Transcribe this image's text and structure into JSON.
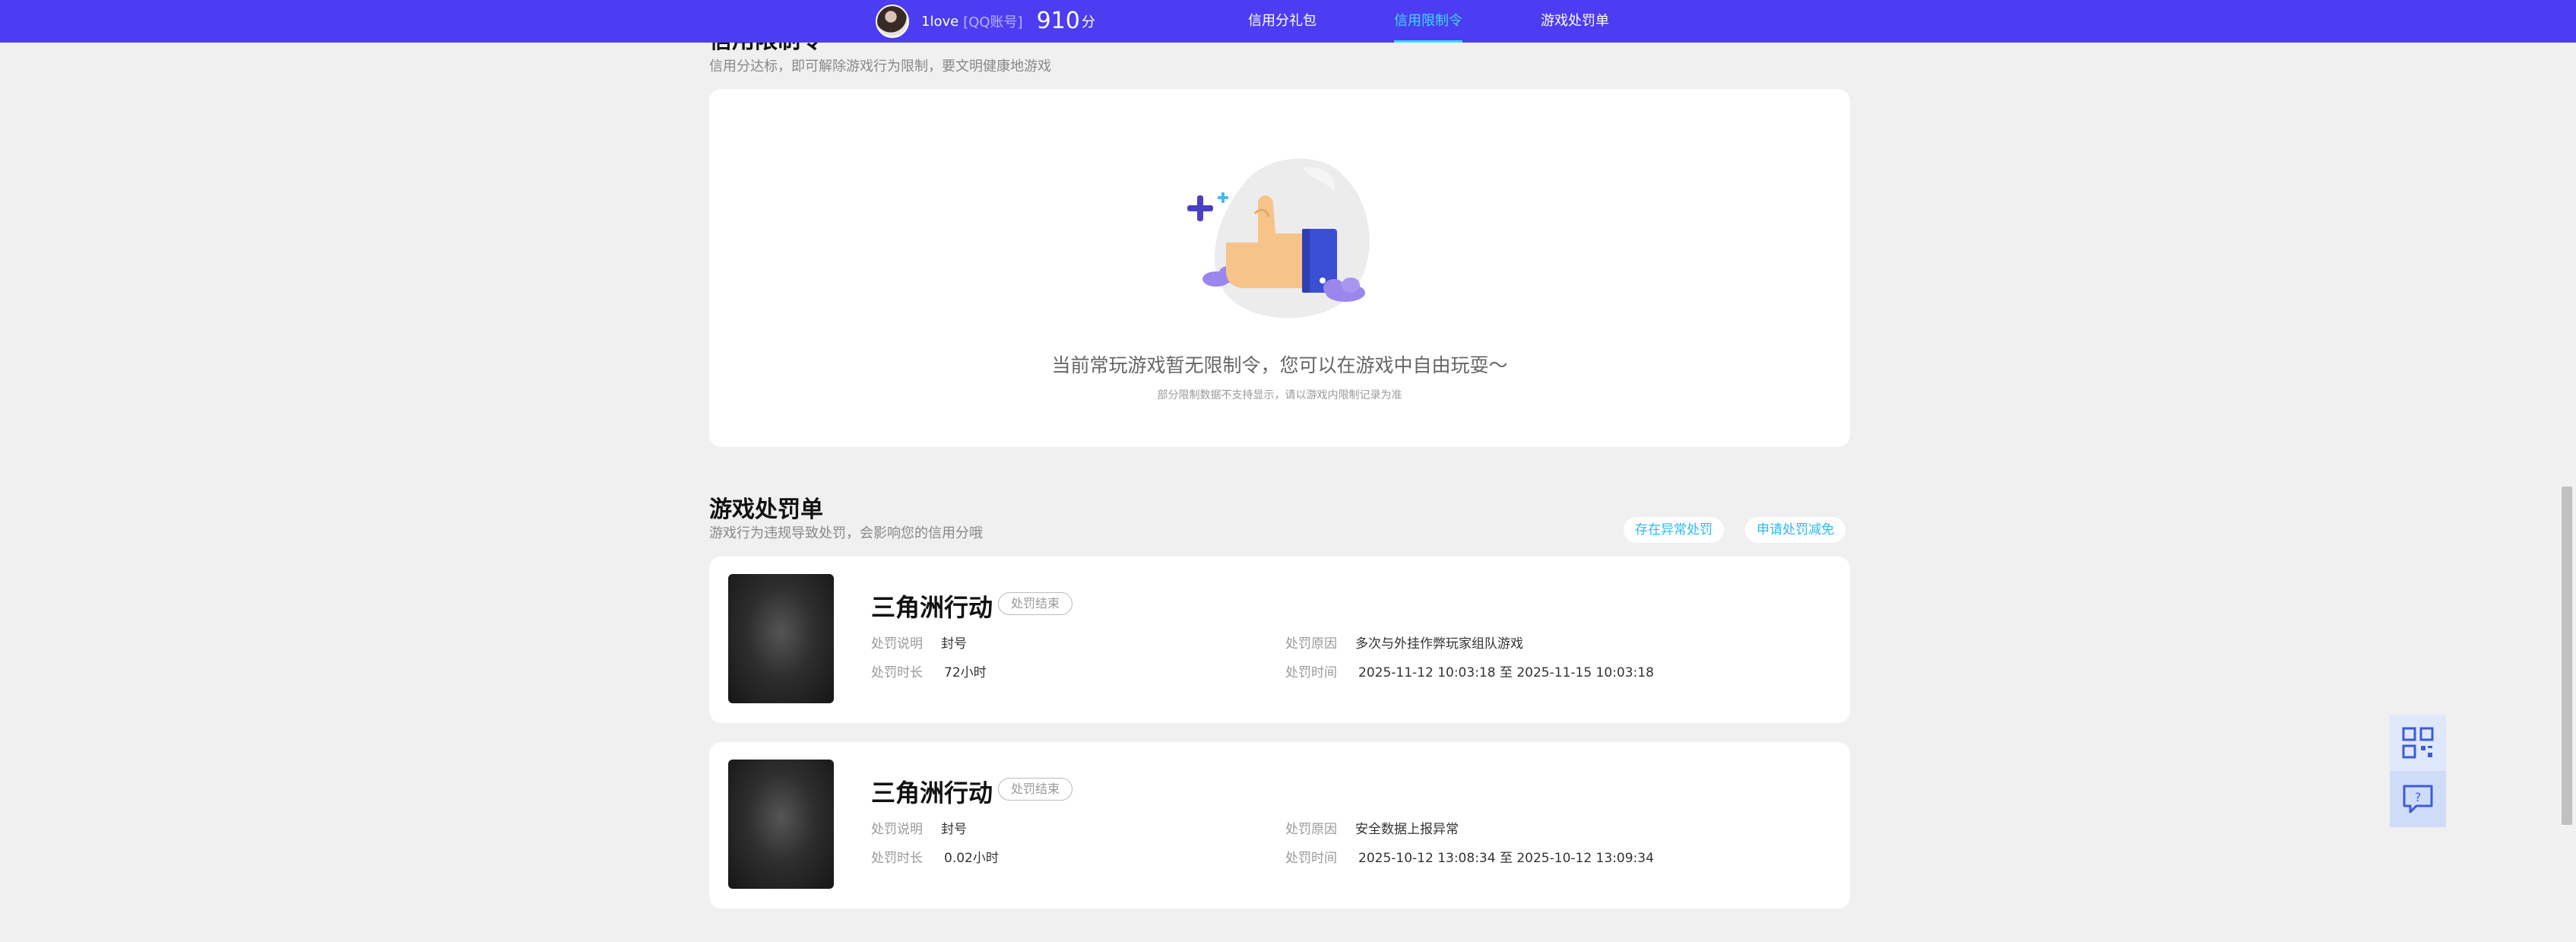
{
  "header": {
    "username": "1love",
    "account_type": "[QQ账号]",
    "score": "910",
    "score_unit": "分",
    "nav": [
      {
        "label": "信用分礼包"
      },
      {
        "label": "信用限制令"
      },
      {
        "label": "游戏处罚单"
      }
    ],
    "active_nav": "信用限制令"
  },
  "restriction": {
    "title": "信用限制令",
    "subtitle": "信用分达标，即可解除游戏行为限制，要文明健康地游戏",
    "empty_title": "当前常玩游戏暂无限制令，您可以在游戏中自由玩耍～",
    "empty_note": "部分限制数据不支持显示，请以游戏内限制记录为准"
  },
  "penalty": {
    "title": "游戏处罚单",
    "subtitle": "游戏行为违规导致处罚，会影响您的信用分哦",
    "actions": {
      "abnormal": "存在异常处罚",
      "apply": "申请处罚减免"
    },
    "labels": {
      "desc": "处罚说明",
      "duration": "处罚时长",
      "reason": "处罚原因",
      "time": "处罚时间"
    },
    "items": [
      {
        "game": "三角洲行动",
        "status": "处罚结束",
        "desc": "封号",
        "duration": "72小时",
        "reason": "多次与外挂作弊玩家组队游戏",
        "time": "2025-11-12 10:03:18 至 2025-11-15 10:03:18"
      },
      {
        "game": "三角洲行动",
        "status": "处罚结束",
        "desc": "封号",
        "duration": "0.02小时",
        "reason": "安全数据上报异常",
        "time": "2025-10-12 13:08:34 至 2025-10-12 13:09:34"
      }
    ]
  },
  "side_tools": {
    "qr_icon": "qrcode-icon",
    "feedback_icon": "question-chat-icon"
  },
  "colors": {
    "header_bg": "#4c3df2",
    "active_nav": "#3fd9ff",
    "pill_text": "#2bb9f0"
  }
}
